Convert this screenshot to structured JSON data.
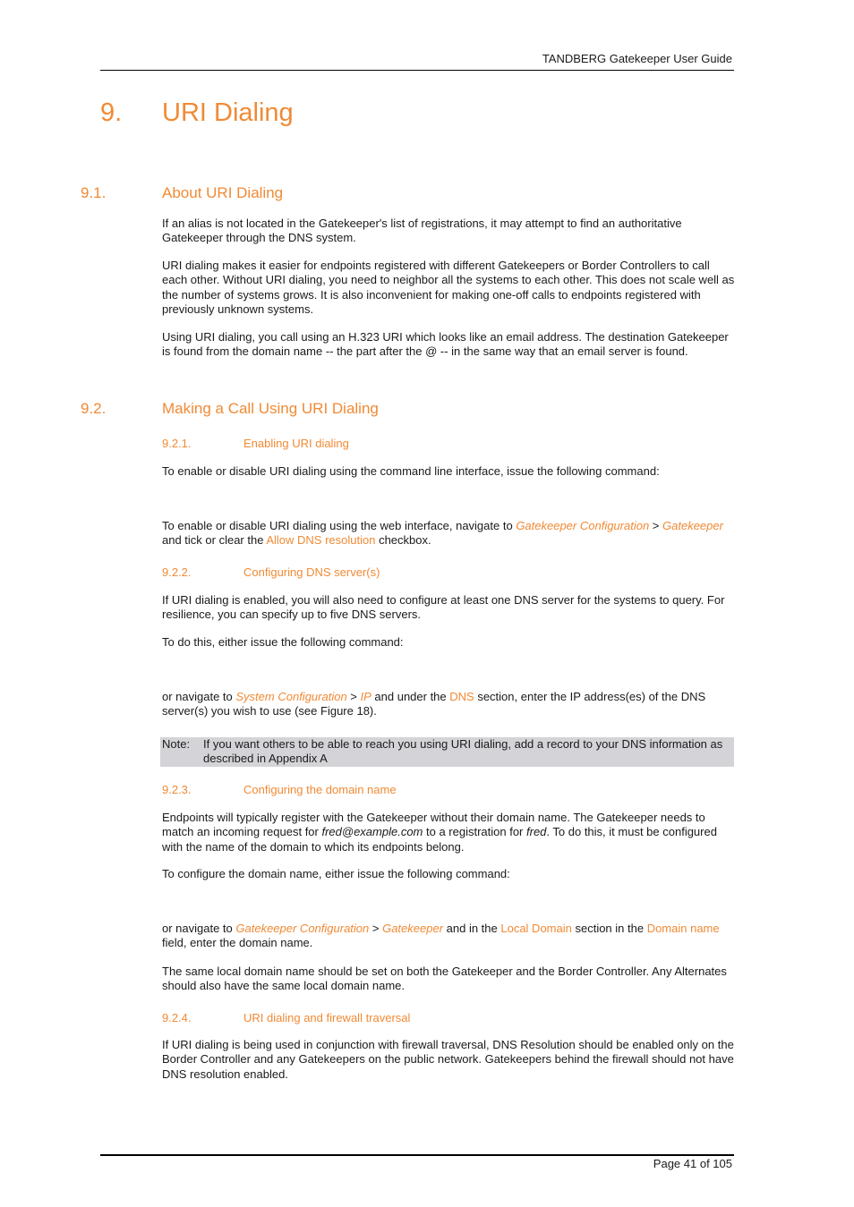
{
  "header": {
    "doc_title": "TANDBERG Gatekeeper User Guide"
  },
  "footer": {
    "page": "Page 41 of 105"
  },
  "chapter": {
    "number": "9.",
    "title": "URI Dialing"
  },
  "s91": {
    "number": "9.1.",
    "title": "About URI Dialing",
    "p1": "If an alias is not located in the Gatekeeper's list of registrations, it may attempt to find an authoritative Gatekeeper through the DNS system.",
    "p2": "URI dialing makes it easier for endpoints registered with different Gatekeepers or Border Controllers to call each other. Without URI dialing, you need to neighbor all the systems to each other. This does not scale well as the number of systems grows. It is also inconvenient for making one-off calls to endpoints registered with previously unknown systems.",
    "p3": "Using URI dialing, you call using an H.323 URI which looks like an email address. The destination Gatekeeper is found from the domain name -- the part after the @ -- in the same way that an email server is found."
  },
  "s92": {
    "number": "9.2.",
    "title": "Making a Call Using URI Dialing",
    "s921": {
      "number": "9.2.1.",
      "title": "Enabling URI dialing",
      "p1": "To enable or disable URI dialing using the command line interface, issue the following command:",
      "p2": {
        "a": "To enable or disable URI dialing using the web interface, navigate to ",
        "link1": "Gatekeeper Configuration",
        "b": " > ",
        "link2": "Gatekeeper",
        "c": " and tick or clear the ",
        "link3": "Allow DNS resolution",
        "d": " checkbox."
      }
    },
    "s922": {
      "number": "9.2.2.",
      "title": "Configuring DNS server(s)",
      "p1": "If URI dialing is enabled, you will also need to configure at least one DNS server for the systems to query. For resilience, you can specify up to five DNS servers.",
      "p2": "To do this, either issue the following command:",
      "p3": {
        "a": "or navigate to ",
        "link1": "System Configuration",
        "b": " > ",
        "link2": "IP",
        "c": " and under the ",
        "link3": "DNS",
        "d": " section, enter the IP address(es) of the DNS server(s) you wish to use (see Figure 18)."
      },
      "note": {
        "label": "Note:",
        "text": "If you want others to be able to reach you using URI dialing, add a record to your DNS information as described in Appendix A"
      }
    },
    "s923": {
      "number": "9.2.3.",
      "title": "Configuring the domain name",
      "p1": {
        "a": "Endpoints will typically register with the Gatekeeper without their domain name. The Gatekeeper needs to match an incoming request for ",
        "em1": "fred@example.com",
        "b": " to a registration for ",
        "em2": "fred",
        "c": ". To do this, it must be configured with the name of the domain to which its endpoints belong."
      },
      "p2": "To configure the domain name, either issue the following command:",
      "p3": {
        "a": "or navigate to ",
        "link1": "Gatekeeper Configuration",
        "b": " > ",
        "link2": "Gatekeeper",
        "c": " and in the ",
        "link3": "Local Domain",
        "d": " section in the ",
        "link4": "Domain name",
        "e": " field, enter the domain name."
      },
      "p4": "The same local domain name should be set on both the Gatekeeper and the Border Controller. Any Alternates should also have the same local domain name."
    },
    "s924": {
      "number": "9.2.4.",
      "title": "URI dialing and firewall traversal",
      "p1": "If URI dialing is being used in conjunction with firewall traversal, DNS Resolution should be enabled only on the Border Controller and any Gatekeepers on the public network. Gatekeepers behind the firewall should not have DNS resolution enabled."
    }
  },
  "colors": {
    "accent": "#f08a35",
    "note_bg": "#d4d4d8",
    "text": "#1a1a1a"
  }
}
